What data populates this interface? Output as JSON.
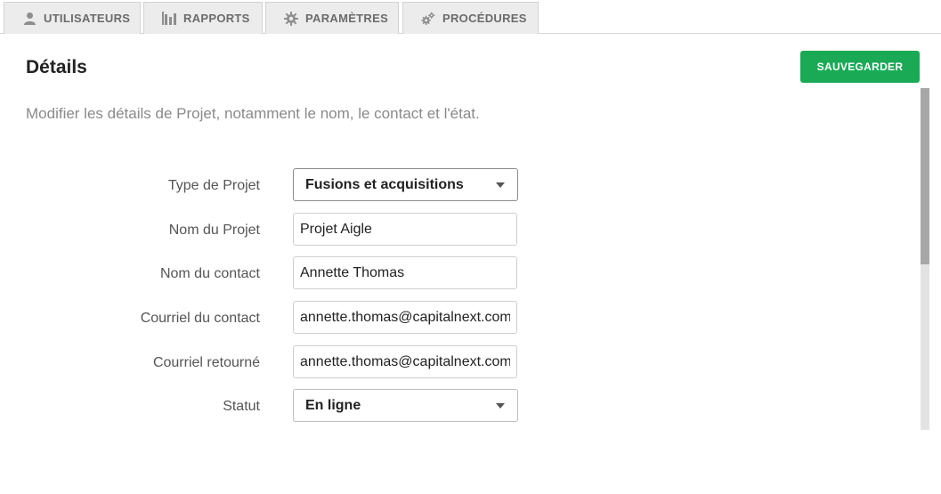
{
  "tabs": [
    {
      "label": "UTILISATEURS",
      "icon": "user-icon"
    },
    {
      "label": "RAPPORTS",
      "icon": "bar-chart-icon"
    },
    {
      "label": "PARAMÈTRES",
      "icon": "gear-icon"
    },
    {
      "label": "PROCÉDURES",
      "icon": "gears-icon"
    }
  ],
  "header": {
    "title": "Détails",
    "subtitle": "Modifier les détails de Projet, notamment le nom, le contact et l'état.",
    "save_label": "SAUVEGARDER"
  },
  "form": {
    "project_type": {
      "label": "Type de Projet",
      "value": "Fusions et acquisitions"
    },
    "project_name": {
      "label": "Nom du Projet",
      "value": "Projet Aigle"
    },
    "contact_name": {
      "label": "Nom du contact",
      "value": "Annette Thomas"
    },
    "contact_email": {
      "label": "Courriel du contact",
      "value": "annette.thomas@capitalnext.com"
    },
    "return_email": {
      "label": "Courriel retourné",
      "value": "annette.thomas@capitalnext.com"
    },
    "status": {
      "label": "Statut",
      "value": "En ligne"
    }
  },
  "colors": {
    "accent": "#1aaa55",
    "tab_bg": "#ececec",
    "muted_text": "#8a8a8a"
  }
}
